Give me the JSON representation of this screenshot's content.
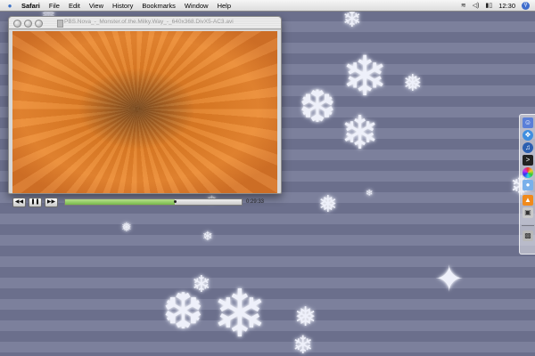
{
  "menubar": {
    "apple_icon": "apple-icon",
    "items": [
      "Safari",
      "File",
      "Edit",
      "View",
      "History",
      "Bookmarks",
      "Window",
      "Help"
    ],
    "clock": "12:30"
  },
  "player": {
    "title": "PBS.Nova_-_Monster.of.the.Milky.Way_-_640x368.DivX5-AC3.avi",
    "time": "0:29:33",
    "progress_fraction": 0.62,
    "buttons": [
      {
        "name": "rewind-button",
        "icon": "rewind-icon",
        "glyph": "◀◀"
      },
      {
        "name": "pause-button",
        "icon": "pause-icon",
        "glyph": "❚❚"
      },
      {
        "name": "fast-forward-button",
        "icon": "fast-forward-icon",
        "glyph": "▶▶"
      }
    ]
  },
  "desktop": {
    "background_colors": [
      "#7c809c",
      "#6b6f8c"
    ]
  },
  "dock": {
    "icons": [
      "finder-icon",
      "safari-icon",
      "itunes-icon",
      "terminal-icon",
      "color-picker-icon",
      "ichat-icon",
      "vlc-icon",
      "drive-icon",
      "trash-icon"
    ]
  }
}
